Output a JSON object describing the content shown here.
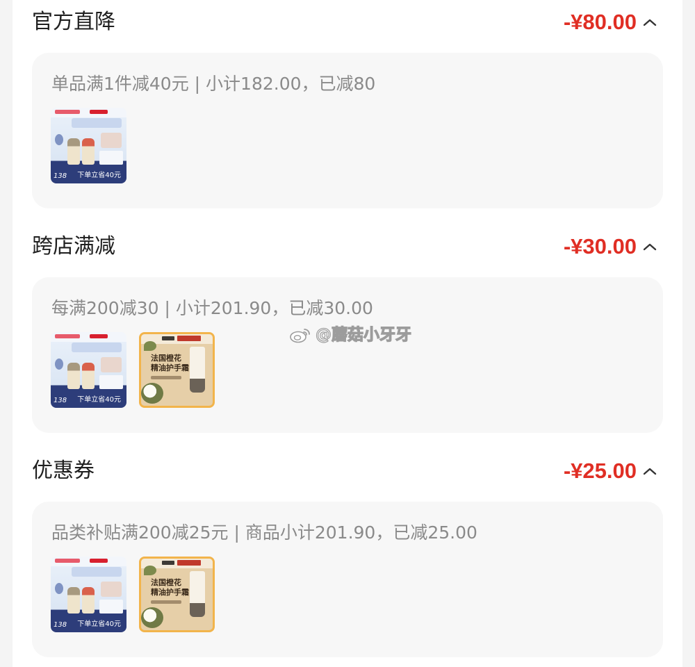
{
  "sections": [
    {
      "title": "官方直降",
      "amount": "-¥80.00",
      "description": "单品满1件减40元 | 小计182.00，已减80",
      "products": [
        {
          "type": "lipstick",
          "price_text": "138",
          "promo_text": "下单立省40元"
        }
      ]
    },
    {
      "title": "跨店满减",
      "amount": "-¥30.00",
      "description": "每满200减30 | 小计201.90，已减30.00",
      "products": [
        {
          "type": "lipstick",
          "price_text": "138",
          "promo_text": "下单立省40元"
        },
        {
          "type": "hand-cream",
          "title_line1": "法国橙花",
          "title_line2": "精油护手霜"
        }
      ]
    },
    {
      "title": "优惠券",
      "amount": "-¥25.00",
      "description": "品类补贴满200减25元 | 商品小计201.90，已减25.00",
      "products": [
        {
          "type": "lipstick",
          "price_text": "138",
          "promo_text": "下单立省40元"
        },
        {
          "type": "hand-cream",
          "title_line1": "法国橙花",
          "title_line2": "精油护手霜"
        }
      ]
    }
  ],
  "watermark": "@蘑菇小牙牙",
  "colors": {
    "accent_red": "#e02e24",
    "card_bg": "#f7f7f7",
    "text_gray": "#8a8a8a"
  }
}
